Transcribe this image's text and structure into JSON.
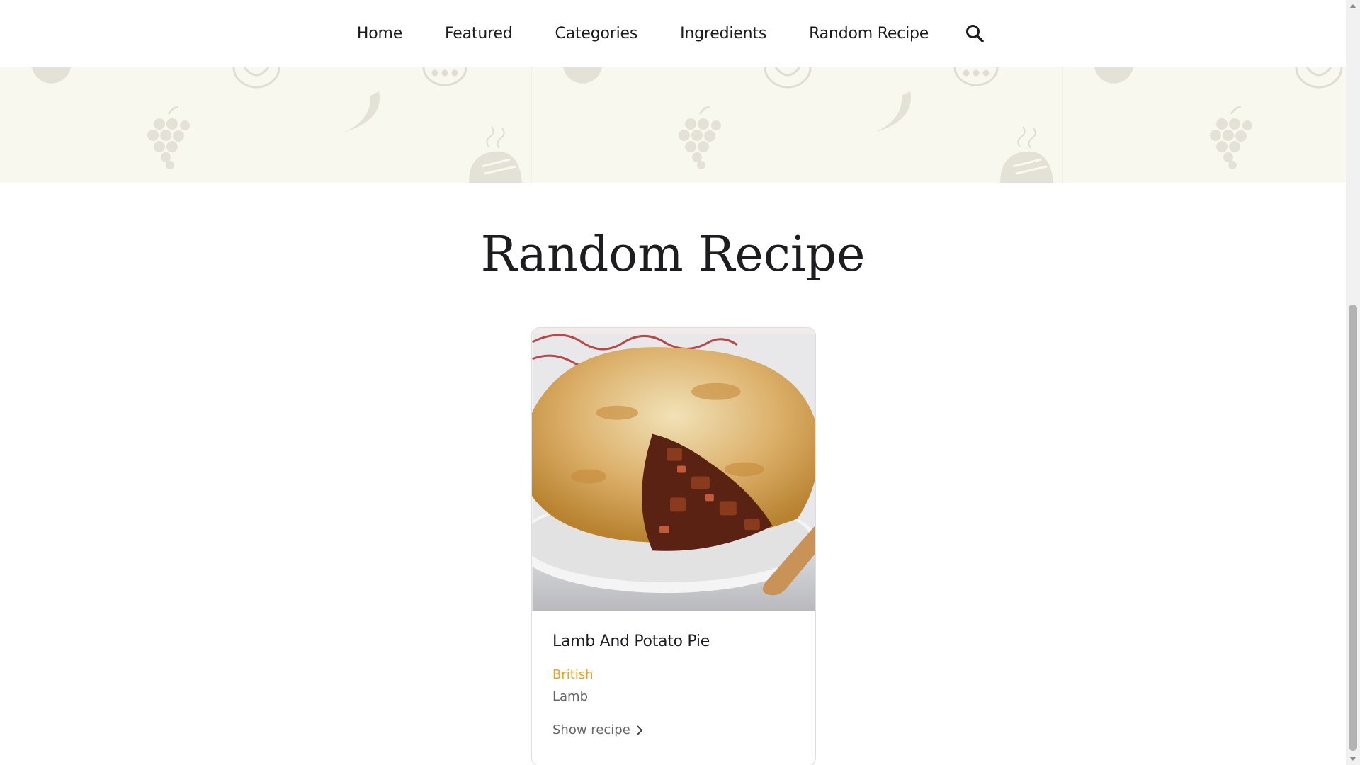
{
  "nav": {
    "items": [
      {
        "label": "Home"
      },
      {
        "label": "Featured"
      },
      {
        "label": "Categories"
      },
      {
        "label": "Ingredients"
      },
      {
        "label": "Random Recipe"
      }
    ],
    "search_icon": "search-icon"
  },
  "main": {
    "title": "Random Recipe"
  },
  "recipe": {
    "title": "Lamb And Potato Pie",
    "area": "British",
    "category": "Lamb",
    "link_label": "Show recipe",
    "image": "lamb-pie-photo"
  },
  "colors": {
    "accent": "#f0a020",
    "banner_bg": "#f9f8ee",
    "text": "#1d1d1f",
    "muted": "#666666"
  }
}
